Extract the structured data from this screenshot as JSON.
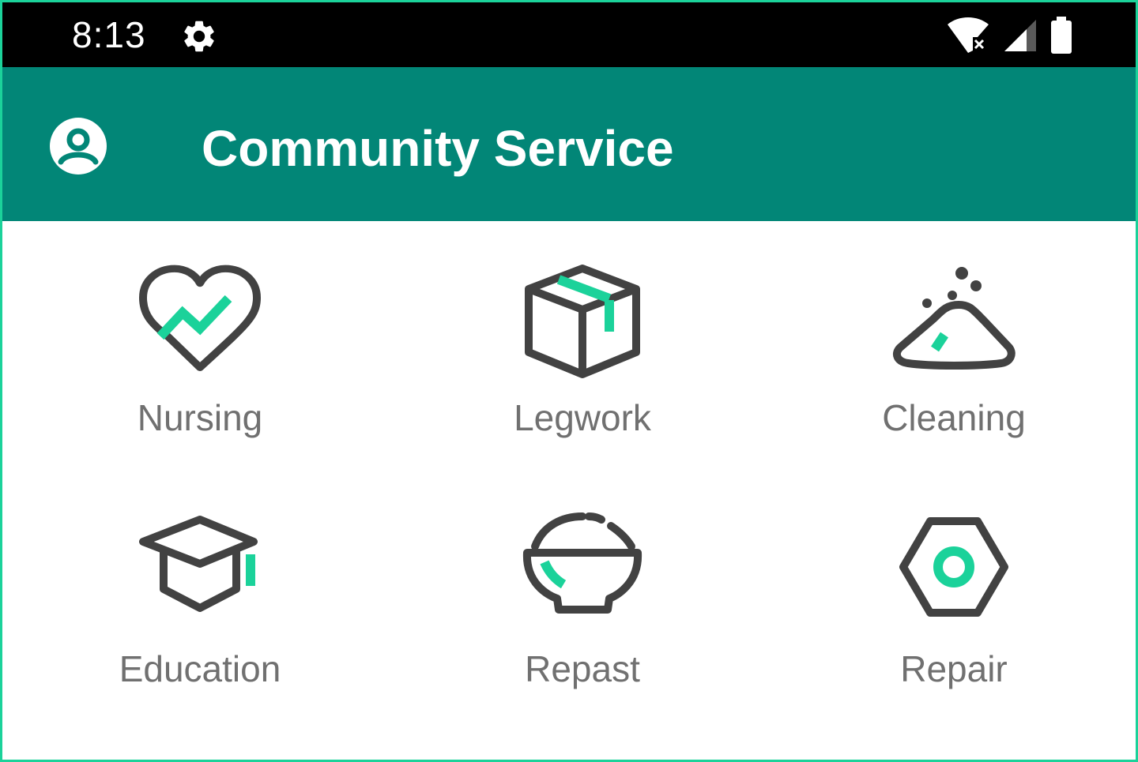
{
  "status_bar": {
    "time": "8:13",
    "icons": [
      "settings-gear-icon",
      "wifi-off-icon",
      "cell-signal-icon",
      "battery-icon"
    ]
  },
  "app_bar": {
    "title": "Community Service",
    "account_icon": "account-circle-icon"
  },
  "services": [
    {
      "label": "Nursing",
      "icon": "heart-pulse-icon"
    },
    {
      "label": "Legwork",
      "icon": "package-box-icon"
    },
    {
      "label": "Cleaning",
      "icon": "dust-pile-icon"
    },
    {
      "label": "Education",
      "icon": "graduation-cap-icon"
    },
    {
      "label": "Repast",
      "icon": "rice-bowl-icon"
    },
    {
      "label": "Repair",
      "icon": "hex-nut-icon"
    }
  ],
  "colors": {
    "status_bar": "#000000",
    "app_bar": "#028677",
    "accent": "#1bd29a",
    "icon_stroke": "#424242",
    "label_text": "#707070"
  }
}
